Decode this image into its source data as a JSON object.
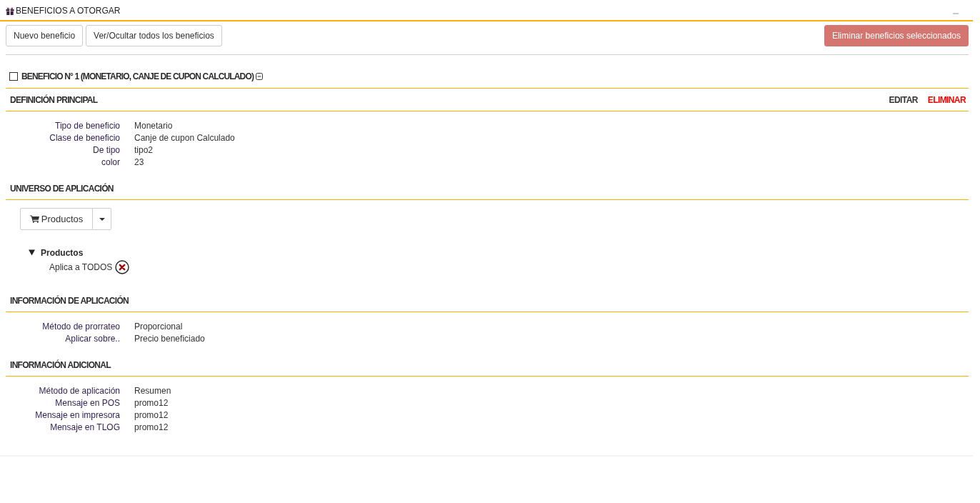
{
  "panel": {
    "title": "BENEFICIOS A OTORGAR"
  },
  "toolbar": {
    "buttons": [
      {
        "label": "Nuevo beneficio"
      },
      {
        "label": "Ver/Ocultar todos los beneficios"
      }
    ],
    "delete_button": {
      "label": "Eliminar beneficios seleccionados",
      "disabled": true
    }
  },
  "benefits": [
    {
      "title": "BENEFICIO N° 1 (MONETARIO, CANJE DE CUPON CALCULADO)",
      "checked": false,
      "expanded": true,
      "sections": [
        {
          "kind": "fields",
          "title": "DEFINICIÓN PRINCIPAL",
          "actions": [
            {
              "label": "EDITAR",
              "kind": "edit"
            },
            {
              "label": "ELIMINAR",
              "kind": "delete"
            }
          ],
          "fields": [
            {
              "label": "Tipo de beneficio",
              "value": "Monetario"
            },
            {
              "label": "Clase de beneficio",
              "value": "Canje de cupon Calculado"
            },
            {
              "label": "De tipo",
              "value": "tipo2"
            },
            {
              "label": "color",
              "value": "23"
            }
          ]
        },
        {
          "kind": "universe",
          "title": "UNIVERSO DE APLICACIÓN",
          "selector": {
            "label": "Productos"
          },
          "tree": [
            {
              "label": "Productos",
              "expanded": true,
              "children": [
                {
                  "label": "Aplica a TODOS",
                  "removable": true
                }
              ]
            }
          ]
        },
        {
          "kind": "fields",
          "title": "INFORMACIÓN DE APLICACIÓN",
          "fields": [
            {
              "label": "Método de prorrateo",
              "value": "Proporcional"
            },
            {
              "label": "Aplicar sobre..",
              "value": "Precio beneficiado"
            }
          ]
        },
        {
          "kind": "fields",
          "title": "INFORMACIÓN ADICIONAL",
          "fields": [
            {
              "label": "Método de aplicación",
              "value": "Resumen"
            },
            {
              "label": "Mensaje en POS",
              "value": "promo12"
            },
            {
              "label": "Mensaje en impresora",
              "value": "promo12"
            },
            {
              "label": "Mensaje en TLOG",
              "value": "promo12"
            }
          ]
        }
      ]
    }
  ]
}
